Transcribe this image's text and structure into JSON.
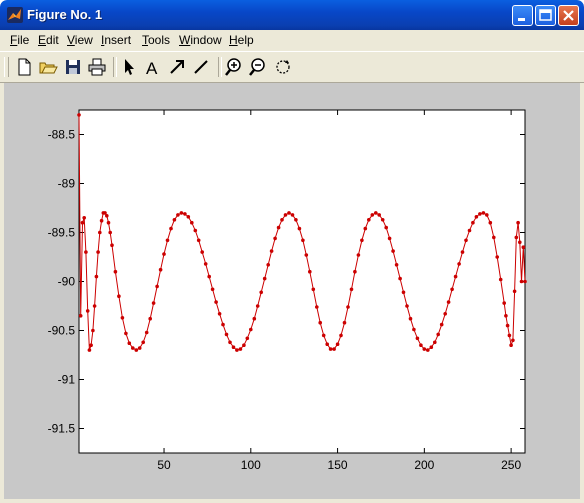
{
  "window": {
    "title": "Figure No. 1",
    "colors": {
      "titlebar": "#0a50d8",
      "face": "#ece9d8",
      "figure_bg": "#c8c8c8"
    }
  },
  "menu": {
    "items": [
      {
        "label": "File",
        "ul": "F",
        "rest": "ile"
      },
      {
        "label": "Edit",
        "ul": "E",
        "rest": "dit"
      },
      {
        "label": "View",
        "ul": "V",
        "rest": "iew"
      },
      {
        "label": "Insert",
        "ul": "I",
        "rest": "nsert"
      },
      {
        "label": "Tools",
        "ul": "T",
        "rest": "ools"
      },
      {
        "label": "Window",
        "ul": "W",
        "rest": "indow"
      },
      {
        "label": "Help",
        "ul": "H",
        "rest": "elp"
      }
    ]
  },
  "toolbar": {
    "icons": [
      "new-file-icon",
      "open-folder-icon",
      "save-icon",
      "print-icon",
      "arrow-pointer-icon",
      "insert-text-icon",
      "insert-arrow-icon",
      "insert-line-icon",
      "zoom-in-icon",
      "zoom-out-icon",
      "rotate-3d-icon"
    ]
  },
  "chart_data": {
    "type": "line",
    "title": "",
    "xlabel": "",
    "ylabel": "",
    "xlim": [
      1,
      258
    ],
    "ylim": [
      -91.75,
      -88.25
    ],
    "xticks": [
      50,
      100,
      150,
      200,
      250
    ],
    "yticks": [
      -88.5,
      -89,
      -89.5,
      -90,
      -90.5,
      -91,
      -91.5
    ],
    "xtick_labels": [
      "50",
      "100",
      "150",
      "200",
      "250"
    ],
    "ytick_labels": [
      "-88.5",
      "-89",
      "-89.5",
      "-90",
      "-90.5",
      "-91",
      "-91.5"
    ],
    "grid": false,
    "marker": "dot",
    "series": [
      {
        "color": "#cc0000",
        "points": [
          [
            1,
            -88.3
          ],
          [
            2,
            -90.35
          ],
          [
            3,
            -89.4
          ],
          [
            4,
            -89.35
          ],
          [
            5,
            -89.7
          ],
          [
            6,
            -90.3
          ],
          [
            7,
            -90.7
          ],
          [
            8,
            -90.65
          ],
          [
            9,
            -90.5
          ],
          [
            10,
            -90.25
          ],
          [
            11,
            -89.95
          ],
          [
            12,
            -89.7
          ],
          [
            13,
            -89.5
          ],
          [
            14,
            -89.38
          ],
          [
            15,
            -89.3
          ],
          [
            16,
            -89.3
          ],
          [
            17,
            -89.33
          ],
          [
            18,
            -89.4
          ],
          [
            19,
            -89.5
          ],
          [
            20,
            -89.63
          ],
          [
            22,
            -89.9
          ],
          [
            24,
            -90.15
          ],
          [
            26,
            -90.37
          ],
          [
            28,
            -90.53
          ],
          [
            30,
            -90.63
          ],
          [
            32,
            -90.68
          ],
          [
            34,
            -90.7
          ],
          [
            36,
            -90.68
          ],
          [
            38,
            -90.62
          ],
          [
            40,
            -90.52
          ],
          [
            42,
            -90.38
          ],
          [
            44,
            -90.22
          ],
          [
            46,
            -90.05
          ],
          [
            48,
            -89.88
          ],
          [
            50,
            -89.72
          ],
          [
            52,
            -89.58
          ],
          [
            54,
            -89.46
          ],
          [
            56,
            -89.37
          ],
          [
            58,
            -89.32
          ],
          [
            60,
            -89.3
          ],
          [
            62,
            -89.31
          ],
          [
            64,
            -89.34
          ],
          [
            66,
            -89.4
          ],
          [
            68,
            -89.48
          ],
          [
            70,
            -89.58
          ],
          [
            72,
            -89.7
          ],
          [
            74,
            -89.82
          ],
          [
            76,
            -89.95
          ],
          [
            78,
            -90.08
          ],
          [
            80,
            -90.21
          ],
          [
            82,
            -90.33
          ],
          [
            84,
            -90.44
          ],
          [
            86,
            -90.54
          ],
          [
            88,
            -90.62
          ],
          [
            90,
            -90.67
          ],
          [
            92,
            -90.7
          ],
          [
            94,
            -90.69
          ],
          [
            96,
            -90.65
          ],
          [
            98,
            -90.58
          ],
          [
            100,
            -90.49
          ],
          [
            102,
            -90.38
          ],
          [
            104,
            -90.25
          ],
          [
            106,
            -90.11
          ],
          [
            108,
            -89.97
          ],
          [
            110,
            -89.83
          ],
          [
            112,
            -89.69
          ],
          [
            114,
            -89.56
          ],
          [
            116,
            -89.45
          ],
          [
            118,
            -89.37
          ],
          [
            120,
            -89.32
          ],
          [
            122,
            -89.3
          ],
          [
            124,
            -89.32
          ],
          [
            126,
            -89.37
          ],
          [
            128,
            -89.46
          ],
          [
            130,
            -89.58
          ],
          [
            132,
            -89.73
          ],
          [
            134,
            -89.9
          ],
          [
            136,
            -90.08
          ],
          [
            138,
            -90.26
          ],
          [
            140,
            -90.42
          ],
          [
            142,
            -90.55
          ],
          [
            144,
            -90.64
          ],
          [
            146,
            -90.69
          ],
          [
            148,
            -90.69
          ],
          [
            150,
            -90.64
          ],
          [
            152,
            -90.55
          ],
          [
            154,
            -90.42
          ],
          [
            156,
            -90.26
          ],
          [
            158,
            -90.08
          ],
          [
            160,
            -89.9
          ],
          [
            162,
            -89.73
          ],
          [
            164,
            -89.58
          ],
          [
            166,
            -89.46
          ],
          [
            168,
            -89.37
          ],
          [
            170,
            -89.32
          ],
          [
            172,
            -89.3
          ],
          [
            174,
            -89.32
          ],
          [
            176,
            -89.37
          ],
          [
            178,
            -89.45
          ],
          [
            180,
            -89.56
          ],
          [
            182,
            -89.69
          ],
          [
            184,
            -89.83
          ],
          [
            186,
            -89.97
          ],
          [
            188,
            -90.11
          ],
          [
            190,
            -90.25
          ],
          [
            192,
            -90.38
          ],
          [
            194,
            -90.49
          ],
          [
            196,
            -90.58
          ],
          [
            198,
            -90.65
          ],
          [
            200,
            -90.69
          ],
          [
            202,
            -90.7
          ],
          [
            204,
            -90.67
          ],
          [
            206,
            -90.62
          ],
          [
            208,
            -90.54
          ],
          [
            210,
            -90.44
          ],
          [
            212,
            -90.33
          ],
          [
            214,
            -90.21
          ],
          [
            216,
            -90.08
          ],
          [
            218,
            -89.95
          ],
          [
            220,
            -89.82
          ],
          [
            222,
            -89.7
          ],
          [
            224,
            -89.58
          ],
          [
            226,
            -89.48
          ],
          [
            228,
            -89.4
          ],
          [
            230,
            -89.34
          ],
          [
            232,
            -89.31
          ],
          [
            234,
            -89.3
          ],
          [
            236,
            -89.32
          ],
          [
            238,
            -89.4
          ],
          [
            240,
            -89.55
          ],
          [
            242,
            -89.75
          ],
          [
            244,
            -89.98
          ],
          [
            246,
            -90.22
          ],
          [
            247,
            -90.35
          ],
          [
            248,
            -90.45
          ],
          [
            249,
            -90.55
          ],
          [
            250,
            -90.65
          ],
          [
            251,
            -90.6
          ],
          [
            252,
            -90.1
          ],
          [
            253,
            -89.55
          ],
          [
            254,
            -89.4
          ],
          [
            255,
            -89.6
          ],
          [
            256,
            -90.0
          ],
          [
            257,
            -89.65
          ],
          [
            258,
            -90.0
          ]
        ]
      }
    ]
  }
}
